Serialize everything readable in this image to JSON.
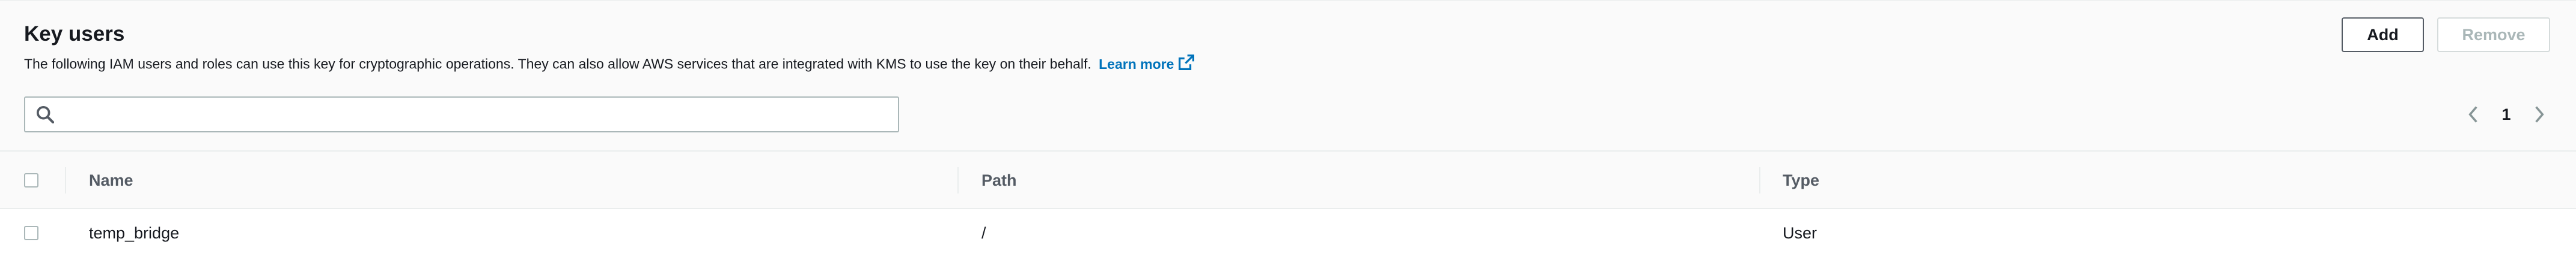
{
  "section": {
    "title": "Key users",
    "description": "The following IAM users and roles can use this key for cryptographic operations. They can also allow AWS services that are integrated with KMS to use the key on their behalf.",
    "learn_more_label": "Learn more",
    "learn_more_icon": "external-link-icon"
  },
  "actions": {
    "add_label": "Add",
    "remove_label": "Remove"
  },
  "search": {
    "value": "",
    "placeholder": "",
    "icon": "search-icon"
  },
  "pagination": {
    "current_page": "1",
    "prev_icon": "chevron-left-icon",
    "next_icon": "chevron-right-icon"
  },
  "table": {
    "columns": [
      "Name",
      "Path",
      "Type"
    ],
    "rows": [
      {
        "name": "temp_bridge",
        "path": "/",
        "type": "User"
      }
    ]
  },
  "colors": {
    "link": "#0073bb",
    "text": "#16191f",
    "muted": "#aab7b8",
    "background": "#fafafa"
  }
}
